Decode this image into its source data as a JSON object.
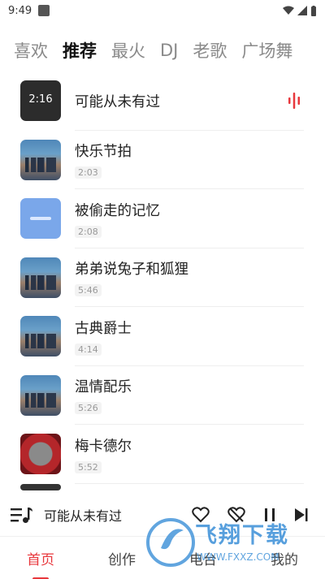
{
  "status": {
    "time": "9:49"
  },
  "tabs": [
    {
      "label": "喜欢",
      "active": false
    },
    {
      "label": "推荐",
      "active": true
    },
    {
      "label": "最火",
      "active": false
    },
    {
      "label": "DJ",
      "active": false
    },
    {
      "label": "老歌",
      "active": false
    },
    {
      "label": "广场舞",
      "active": false
    }
  ],
  "songs": [
    {
      "title": "可能从未有过",
      "duration": "2:16",
      "cover": "dark",
      "playing": true
    },
    {
      "title": "快乐节拍",
      "duration": "2:03",
      "cover": "city",
      "playing": false
    },
    {
      "title": "被偷走的记忆",
      "duration": "2:08",
      "cover": "blue",
      "playing": false
    },
    {
      "title": "弟弟说兔子和狐狸",
      "duration": "5:46",
      "cover": "city",
      "playing": false
    },
    {
      "title": "古典爵士",
      "duration": "4:14",
      "cover": "city",
      "playing": false
    },
    {
      "title": "温情配乐",
      "duration": "5:26",
      "cover": "city",
      "playing": false
    },
    {
      "title": "梅卡德尔",
      "duration": "5:52",
      "cover": "red",
      "playing": false
    }
  ],
  "player": {
    "now_playing": "可能从未有过"
  },
  "bottom_nav": [
    {
      "label": "首页",
      "active": true
    },
    {
      "label": "创作",
      "active": false
    },
    {
      "label": "电台",
      "active": false
    },
    {
      "label": "我的",
      "active": false
    }
  ],
  "watermark": {
    "text": "飞翔下载",
    "url": "WWW.FXXZ.COM"
  },
  "colors": {
    "accent": "#e8373c",
    "watermark": "#3a8fd8"
  }
}
